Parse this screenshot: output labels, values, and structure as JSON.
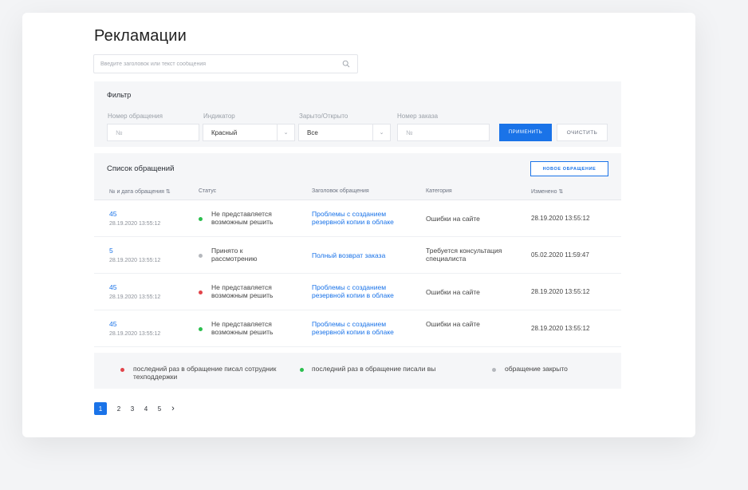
{
  "page": {
    "title": "Рекламации"
  },
  "search": {
    "placeholder": "Введите заголовок или текст сообщения"
  },
  "filter": {
    "heading": "Фильтр",
    "fields": [
      {
        "label": "Номер обращения",
        "value": "№",
        "is_placeholder": true
      },
      {
        "label": "Индикатор",
        "value": "Красный"
      },
      {
        "label": "Зарыто/Открыто",
        "value": "Все"
      },
      {
        "label": "Номер заказа",
        "value": "№",
        "is_placeholder": true
      }
    ],
    "apply_label": "ПРИМЕНИТЬ",
    "clear_label": "ОЧИСТИТЬ"
  },
  "list": {
    "heading": "Список обращений",
    "new_button": "НОВОЕ ОБРАЩЕНИЕ",
    "columns": [
      "№ и дата обращения ⇅",
      "Статус",
      "Заголовок обращения",
      "Категория",
      "Изменено ⇅"
    ],
    "rows": [
      {
        "number": "45",
        "date": "28.19.2020 13:55:12",
        "status_color": "#2bbf4e",
        "status": "Не представляется возможным решить",
        "subject": "Проблемы с созданием резервной копии в облаке",
        "category": "Ошибки на сайте",
        "changed": "28.19.2020 13:55:12"
      },
      {
        "number": "5",
        "date": "28.19.2020 13:55:12",
        "status_color": "#b5b8bd",
        "status": "Принято к рассмотрению",
        "subject": "Полный возврат заказа",
        "category": "Требуется консультация специалиста",
        "changed": "05.02.2020 11:59:47"
      },
      {
        "number": "45",
        "date": "28.19.2020 13:55:12",
        "status_color": "#e2444a",
        "status": "Не представляется возможным решить",
        "subject": "Проблемы с созданием резервной копии в облаке",
        "category": "Ошибки на сайте",
        "changed": "28.19.2020 13:55:12"
      },
      {
        "number": "45",
        "date": "28.19.2020 13:55:12",
        "status_color": "#2bbf4e",
        "status": "Не представляется возможным решить",
        "subject": "Проблемы с созданием резервной копии в облаке",
        "category": "Ошибки на сайте",
        "changed": "28.19.2020 13:55:12"
      }
    ]
  },
  "legend": [
    {
      "color": "#e2444a",
      "text": "последний раз в обращение писал сотрудник техподдержки"
    },
    {
      "color": "#2bbf4e",
      "text": "последний раз в обращение писали вы"
    },
    {
      "color": "#b5b8bd",
      "text": "обращение закрыто"
    }
  ],
  "pagination": {
    "pages": [
      "1",
      "2",
      "3",
      "4",
      "5"
    ],
    "current": "1",
    "next": "›"
  },
  "colors": {
    "accent": "#1a73e8"
  }
}
